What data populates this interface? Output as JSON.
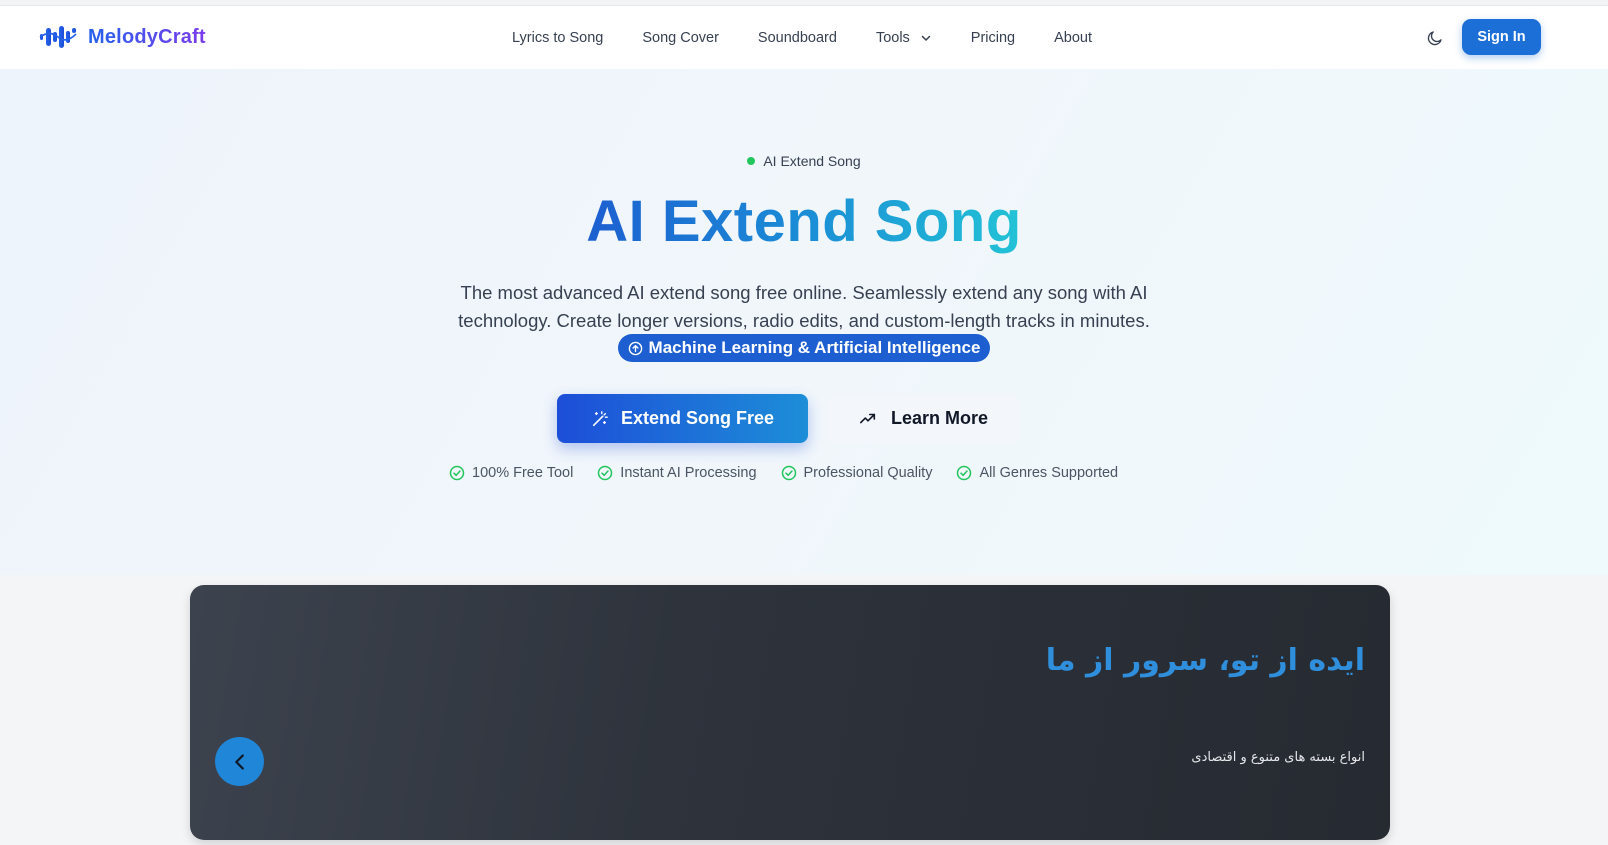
{
  "brand": {
    "name": "MelodyCraft"
  },
  "nav": {
    "items": [
      {
        "label": "Lyrics to Song"
      },
      {
        "label": "Song Cover"
      },
      {
        "label": "Soundboard"
      },
      {
        "label": "Tools"
      },
      {
        "label": "Pricing"
      },
      {
        "label": "About"
      }
    ]
  },
  "header": {
    "sign_in_label": "Sign In"
  },
  "hero": {
    "badge": "AI Extend Song",
    "title": "AI Extend Song",
    "description": "The most advanced AI extend song free online. Seamlessly extend any song with AI technology. Create longer versions, radio edits, and custom-length tracks in minutes.",
    "highlight": "Machine Learning & Artificial Intelligence",
    "primary_cta": "Extend Song Free",
    "secondary_cta": "Learn More",
    "features": [
      {
        "label": "100% Free Tool"
      },
      {
        "label": "Instant AI Processing"
      },
      {
        "label": "Professional Quality"
      },
      {
        "label": "All Genres Supported"
      }
    ]
  },
  "banner": {
    "title": "ایده از تو، سرور از ما",
    "subtitle": "انواع بسته های متنوع و اقتصادی"
  },
  "colors": {
    "primary": "#1d5fd0",
    "accent_cyan": "#22c3d6",
    "success": "#22c55e",
    "banner_bg": "#2e333c",
    "banner_title": "#2f8fdc"
  }
}
